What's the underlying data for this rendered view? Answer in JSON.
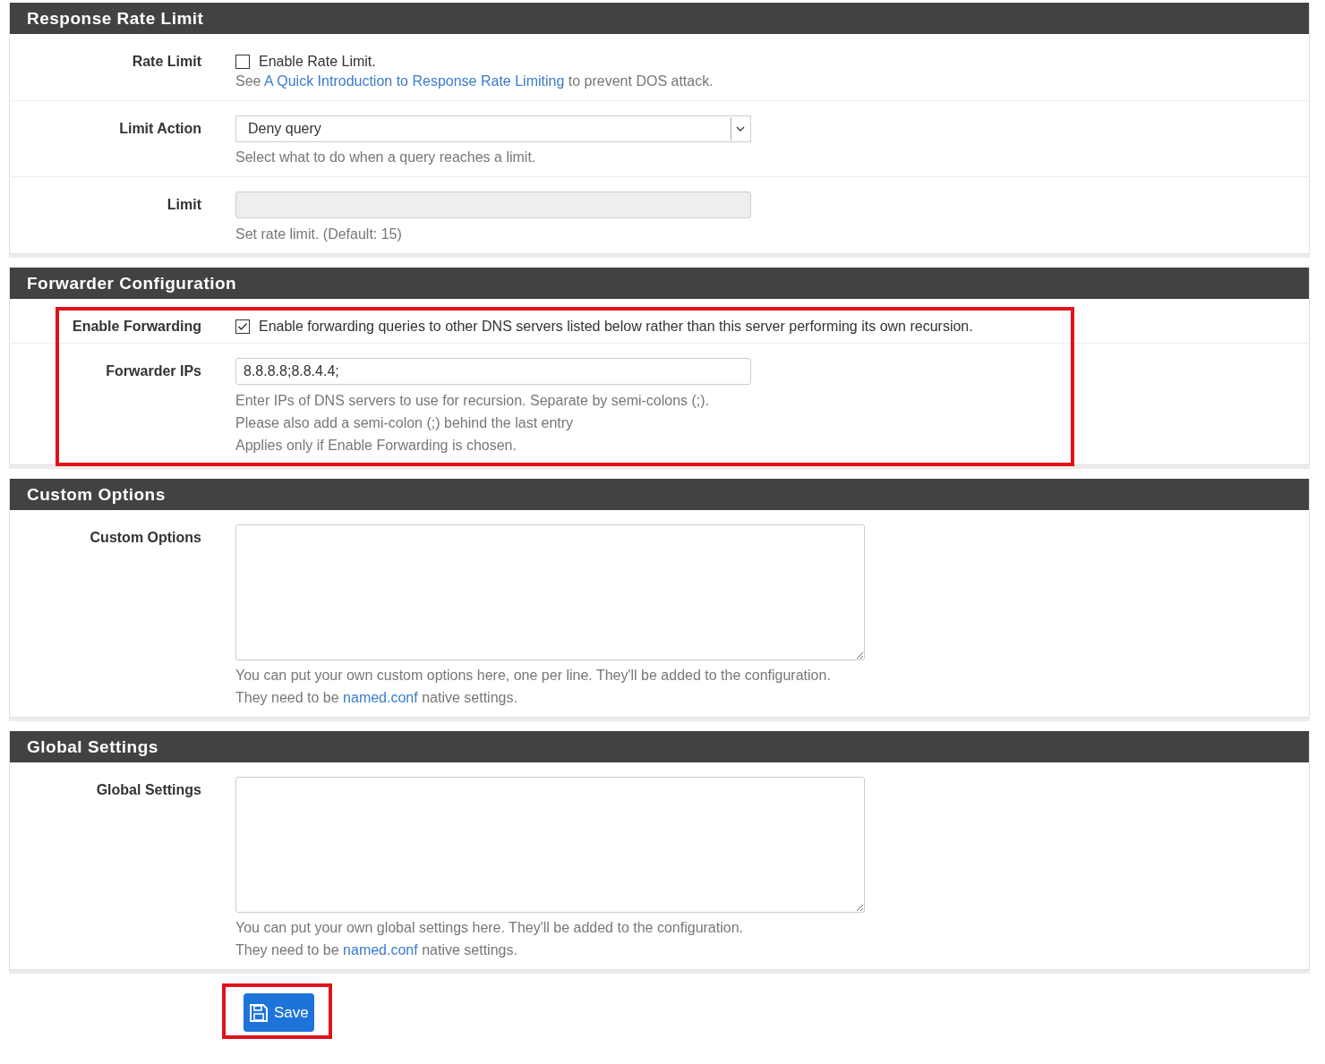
{
  "sections": [
    {
      "title": "Response Rate Limit",
      "highlighted": false,
      "rows": [
        {
          "kind": "checkbox",
          "label": "Rate Limit",
          "checked": false,
          "text": "Enable Rate Limit.",
          "help": [
            [
              {
                "text": "See "
              },
              {
                "link": "A Quick Introduction to Response Rate Limiting"
              },
              {
                "text": " to prevent DOS attack."
              }
            ]
          ]
        },
        {
          "kind": "select",
          "label": "Limit Action",
          "value": "Deny query",
          "help": [
            [
              {
                "text": "Select what to do when a query reaches a limit."
              }
            ]
          ]
        },
        {
          "kind": "input",
          "label": "Limit",
          "disabled": true,
          "help": [
            [
              {
                "text": "Set rate limit. (Default: 15)"
              }
            ]
          ]
        }
      ]
    },
    {
      "title": "Forwarder Configuration",
      "highlighted": true,
      "rows": [
        {
          "kind": "checkbox",
          "label": "Enable Forwarding",
          "checked": true,
          "text": "Enable forwarding queries to other DNS servers listed below rather than this server performing its own recursion."
        },
        {
          "kind": "input",
          "label": "Forwarder IPs",
          "disabled": false,
          "value": "8.8.8.8;8.8.4.4;",
          "help": [
            [
              {
                "text": "Enter IPs of DNS servers to use for recursion. Separate by semi-colons (;)."
              }
            ],
            [
              {
                "text": "Please also add a semi-colon (;) behind the last entry"
              }
            ],
            [
              {
                "text": "Applies only if Enable Forwarding is chosen."
              }
            ]
          ]
        }
      ]
    },
    {
      "title": "Custom Options",
      "highlighted": false,
      "rows": [
        {
          "kind": "textarea",
          "label": "Custom Options",
          "help": [
            [
              {
                "text": "You can put your own custom options here, one per line. They'll be added to the configuration."
              }
            ],
            [
              {
                "text": "They need to be "
              },
              {
                "link": "named.conf"
              },
              {
                "text": " native settings."
              }
            ]
          ]
        }
      ]
    },
    {
      "title": "Global Settings",
      "highlighted": false,
      "rows": [
        {
          "kind": "textarea",
          "label": "Global Settings",
          "help": [
            [
              {
                "text": "You can put your own global settings here. They'll be added to the configuration."
              }
            ],
            [
              {
                "text": "They need to be "
              },
              {
                "link": "named.conf"
              },
              {
                "text": " native settings."
              }
            ]
          ]
        }
      ]
    }
  ],
  "save_button": {
    "label": "Save",
    "highlighted": true
  }
}
